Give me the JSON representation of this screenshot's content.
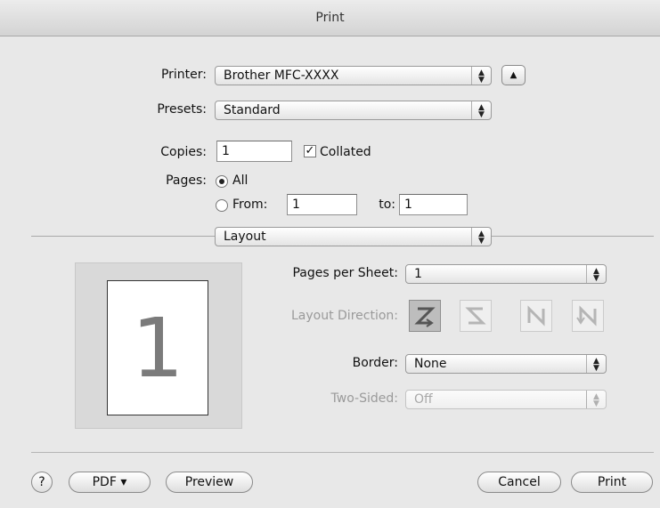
{
  "window": {
    "title": "Print"
  },
  "printer": {
    "label": "Printer:",
    "value": "Brother MFC-XXXX"
  },
  "presets": {
    "label": "Presets:",
    "value": "Standard"
  },
  "copies": {
    "label": "Copies:",
    "value": "1",
    "collated_label": "Collated",
    "collated_checked": true
  },
  "pages": {
    "label": "Pages:",
    "all_label": "All",
    "from_label": "From:",
    "from_value": "1",
    "to_label": "to:",
    "to_value": "1",
    "selected": "All"
  },
  "section": {
    "value": "Layout"
  },
  "preview": {
    "page_number": "1"
  },
  "layout": {
    "pages_per_sheet_label": "Pages per Sheet:",
    "pages_per_sheet_value": "1",
    "direction_label": "Layout Direction:",
    "directions": [
      {
        "name": "z",
        "glyph": "Z",
        "selected": true
      },
      {
        "name": "s-reverse",
        "glyph": "S",
        "selected": false
      },
      {
        "name": "n-reverse",
        "glyph": "N",
        "selected": false
      },
      {
        "name": "n",
        "glyph": "N",
        "selected": false
      }
    ],
    "border_label": "Border:",
    "border_value": "None",
    "two_sided_label": "Two-Sided:",
    "two_sided_value": "Off"
  },
  "footer": {
    "help_label": "?",
    "pdf_label": "PDF ▾",
    "preview_label": "Preview",
    "cancel_label": "Cancel",
    "print_label": "Print"
  }
}
